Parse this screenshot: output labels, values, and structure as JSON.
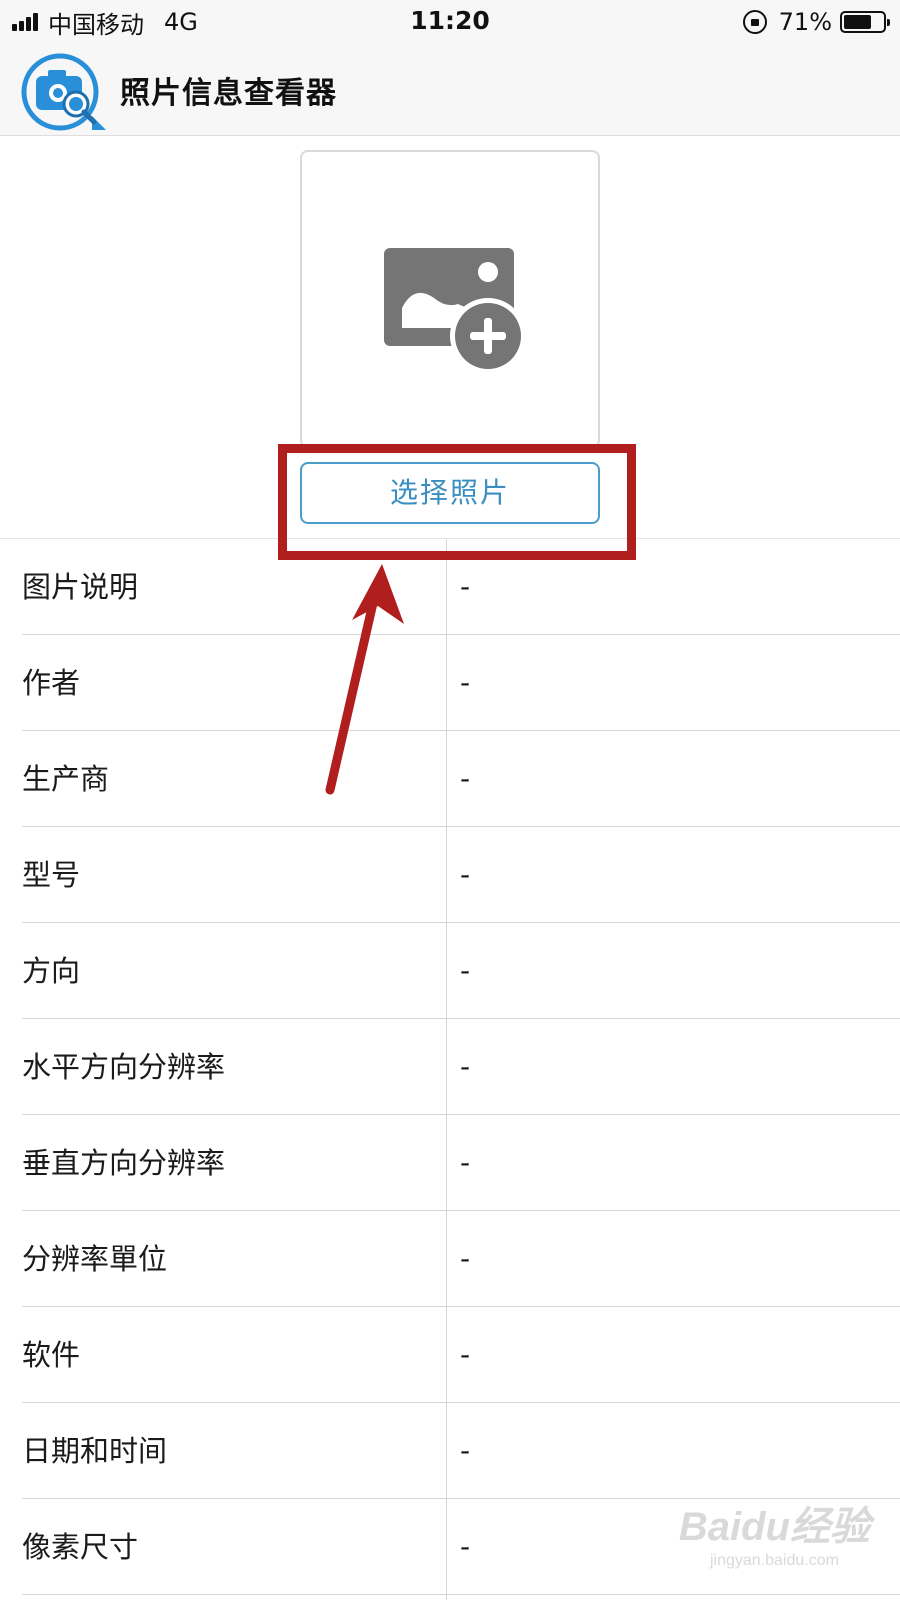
{
  "status_bar": {
    "carrier": "中国移动",
    "network": "4G",
    "time": "11:20",
    "battery_percent_label": "71%",
    "battery_level": 0.71,
    "icons": [
      "signal-bars-icon",
      "orientation-lock-icon",
      "battery-icon"
    ]
  },
  "header": {
    "title": "照片信息查看器",
    "logo_icon": "camera-magnifier-icon",
    "logo_color": "#2a8fd9"
  },
  "picker": {
    "add_photo_icon": "add-photo-icon",
    "select_button_label": "选择照片",
    "accent_color": "#3a8fc0"
  },
  "info_rows": [
    {
      "label": "图片说明",
      "value": "-"
    },
    {
      "label": "作者",
      "value": "-"
    },
    {
      "label": "生产商",
      "value": "-"
    },
    {
      "label": "型号",
      "value": "-"
    },
    {
      "label": "方向",
      "value": "-"
    },
    {
      "label": "水平方向分辨率",
      "value": "-"
    },
    {
      "label": "垂直方向分辨率",
      "value": "-"
    },
    {
      "label": "分辨率單位",
      "value": "-"
    },
    {
      "label": "软件",
      "value": "-"
    },
    {
      "label": "日期和时间",
      "value": "-"
    },
    {
      "label": "像素尺寸",
      "value": "-"
    }
  ],
  "annotation": {
    "color": "#b01e1e"
  },
  "watermark": {
    "logo_text": "Baidu经验",
    "url": "jingyan.baidu.com"
  }
}
